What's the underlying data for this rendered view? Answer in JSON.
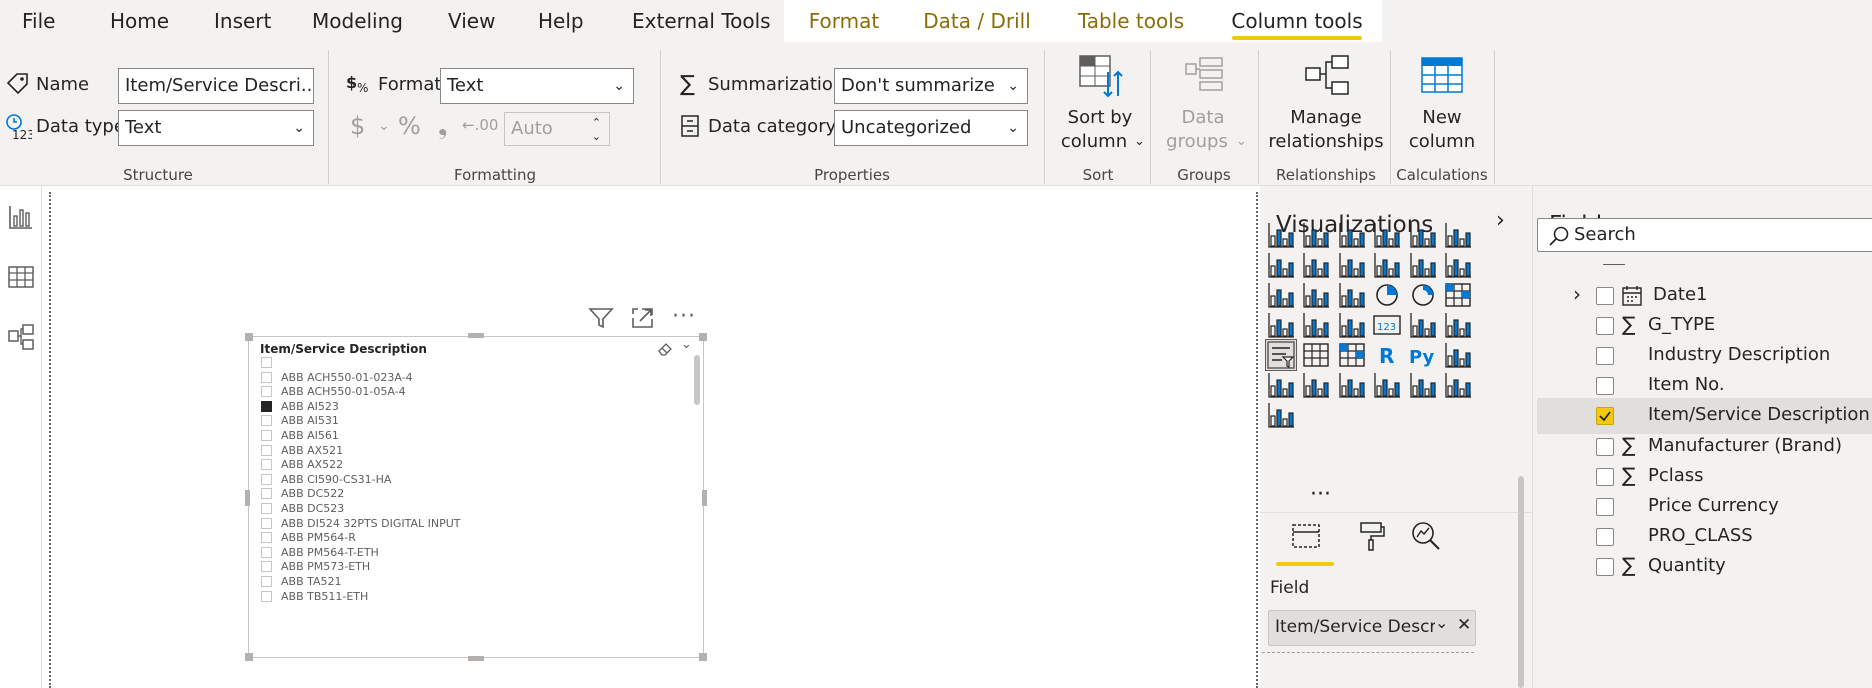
{
  "menu": {
    "items": [
      "File",
      "Home",
      "Insert",
      "Modeling",
      "View",
      "Help",
      "External Tools"
    ],
    "context_tabs": [
      "Format",
      "Data / Drill",
      "Table tools"
    ],
    "active_tab": "Column tools"
  },
  "ribbon": {
    "structure": {
      "name_label": "Name",
      "name_value": "Item/Service Descri...",
      "datatype_label": "Data type",
      "datatype_value": "Text",
      "title": "Structure"
    },
    "formatting": {
      "format_label": "Format",
      "format_value": "Text",
      "currency_symbol": "$",
      "percent_symbol": "%",
      "comma_symbol": "❟",
      "decimal_symbol": "←.00",
      "auto_value": "Auto",
      "title": "Formatting"
    },
    "properties": {
      "summarization_label": "Summarization",
      "summarization_value": "Don't summarize",
      "category_label": "Data category",
      "category_value": "Uncategorized",
      "title": "Properties"
    },
    "sort": {
      "btn_line1": "Sort by",
      "btn_line2": "column",
      "title": "Sort"
    },
    "groups": {
      "btn_line1": "Data",
      "btn_line2": "groups",
      "title": "Groups"
    },
    "relationships": {
      "btn_line1": "Manage",
      "btn_line2": "relationships",
      "title": "Relationships"
    },
    "calculations": {
      "btn_line1": "New",
      "btn_line2": "column",
      "title": "Calculations"
    }
  },
  "slicer": {
    "title": "Item/Service Description",
    "items": [
      {
        "label": "",
        "checked": false
      },
      {
        "label": "ABB ACH550-01-023A-4",
        "checked": false
      },
      {
        "label": "ABB ACH550-01-05A-4",
        "checked": false
      },
      {
        "label": "ABB AI523",
        "checked": true
      },
      {
        "label": "ABB AI531",
        "checked": false
      },
      {
        "label": "ABB AI561",
        "checked": false
      },
      {
        "label": "ABB AX521",
        "checked": false
      },
      {
        "label": "ABB AX522",
        "checked": false
      },
      {
        "label": "ABB CI590-CS31-HA",
        "checked": false
      },
      {
        "label": "ABB DC522",
        "checked": false
      },
      {
        "label": "ABB DC523",
        "checked": false
      },
      {
        "label": "ABB DI524 32PTS DIGITAL INPUT",
        "checked": false
      },
      {
        "label": "ABB PM564-R",
        "checked": false
      },
      {
        "label": "ABB PM564-T-ETH",
        "checked": false
      },
      {
        "label": "ABB PM573-ETH",
        "checked": false
      },
      {
        "label": "ABB TA521",
        "checked": false
      },
      {
        "label": "ABB TB511-ETH",
        "checked": false
      }
    ]
  },
  "visualizations": {
    "title": "Visualizations",
    "field_label": "Field",
    "field_value": "Item/Service Descriptior",
    "more": "···"
  },
  "fields": {
    "title": "Fields",
    "search_placeholder": "Search",
    "items": [
      {
        "name": "Date1",
        "sigma": false,
        "checked": false,
        "table": true
      },
      {
        "name": "G_TYPE",
        "sigma": true,
        "checked": false
      },
      {
        "name": "Industry Description",
        "sigma": false,
        "checked": false
      },
      {
        "name": "Item No.",
        "sigma": false,
        "checked": false
      },
      {
        "name": "Item/Service Description",
        "sigma": false,
        "checked": true
      },
      {
        "name": "Manufacturer (Brand)",
        "sigma": true,
        "checked": false
      },
      {
        "name": "Pclass",
        "sigma": true,
        "checked": false
      },
      {
        "name": "Price Currency",
        "sigma": false,
        "checked": false
      },
      {
        "name": "PRO_CLASS",
        "sigma": false,
        "checked": false
      },
      {
        "name": "Quantity",
        "sigma": true,
        "checked": false
      }
    ]
  }
}
